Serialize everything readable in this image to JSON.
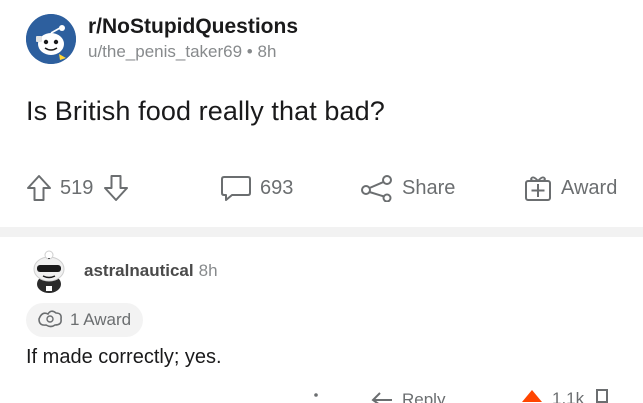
{
  "post": {
    "subreddit": "r/NoStupidQuestions",
    "author": "u/the_penis_taker69",
    "separator": "•",
    "age": "8h",
    "title": "Is British food really that bad?"
  },
  "actions": {
    "upvotes": "519",
    "comments": "693",
    "share_label": "Share",
    "award_label": "Award"
  },
  "comment": {
    "author": "astralnautical",
    "age": "8h",
    "awards_label": "1 Award",
    "body": "If made correctly; yes.",
    "reply_label": "Reply",
    "score": "1.1k"
  },
  "colors": {
    "subreddit_avatar": "#2d5f9e",
    "upvote_active": "#ff4500",
    "meta_gray": "#878a8c",
    "divider": "#f2f2f2"
  },
  "icons": {
    "upvote": "arrow-up-icon",
    "downvote": "arrow-down-icon",
    "comments": "speech-bubble-icon",
    "share": "share-icon",
    "award": "gift-box-icon",
    "comment_award": "award-ribbon-icon",
    "reply": "reply-arrow-icon"
  }
}
